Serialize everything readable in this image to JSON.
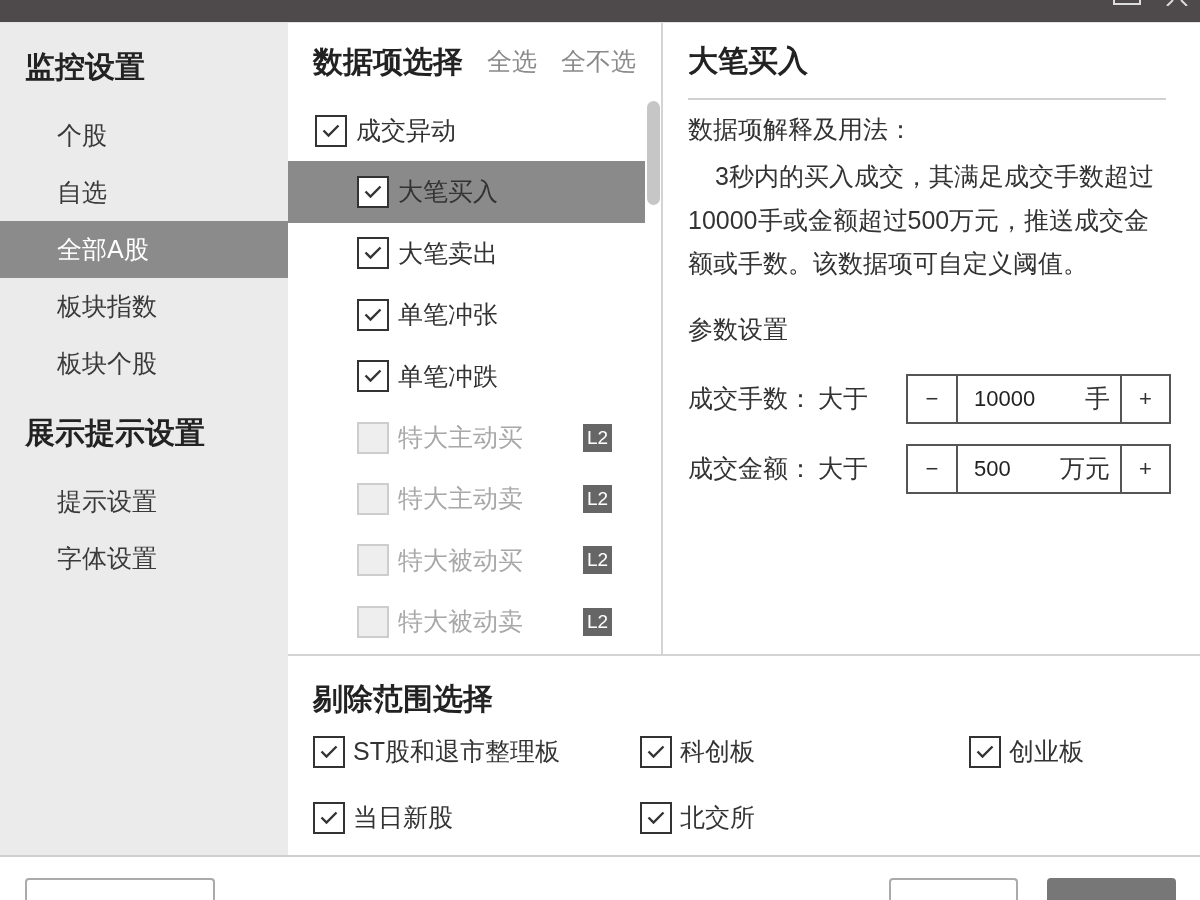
{
  "sidebar": {
    "sections": [
      {
        "heading": "监控设置",
        "items": [
          {
            "label": "个股",
            "selected": false
          },
          {
            "label": "自选",
            "selected": false
          },
          {
            "label": "全部A股",
            "selected": true
          },
          {
            "label": "板块指数",
            "selected": false
          },
          {
            "label": "板块个股",
            "selected": false
          }
        ]
      },
      {
        "heading": "展示提示设置",
        "items": [
          {
            "label": "提示设置",
            "selected": false
          },
          {
            "label": "字体设置",
            "selected": false
          }
        ]
      }
    ]
  },
  "data_items": {
    "title": "数据项选择",
    "actions": [
      "全选",
      "全不选"
    ],
    "tree": [
      {
        "label": "成交异动",
        "checked": true,
        "disabled": false,
        "selected": false,
        "children": [
          {
            "label": "大笔买入",
            "checked": true,
            "disabled": false,
            "selected": true
          },
          {
            "label": "大笔卖出",
            "checked": true,
            "disabled": false,
            "selected": false
          },
          {
            "label": "单笔冲张",
            "checked": true,
            "disabled": false,
            "selected": false
          },
          {
            "label": "单笔冲跌",
            "checked": true,
            "disabled": false,
            "selected": false
          },
          {
            "label": "特大主动买",
            "checked": false,
            "disabled": true,
            "selected": false,
            "badge": "L2"
          },
          {
            "label": "特大主动卖",
            "checked": false,
            "disabled": true,
            "selected": false,
            "badge": "L2"
          },
          {
            "label": "特大被动买",
            "checked": false,
            "disabled": true,
            "selected": false,
            "badge": "L2"
          },
          {
            "label": "特大被动卖",
            "checked": false,
            "disabled": true,
            "selected": false,
            "badge": "L2"
          }
        ]
      }
    ]
  },
  "detail": {
    "title": "大笔买入",
    "usage_label": "数据项解释及用法：",
    "description": "3秒内的买入成交，其满足成交手数超过10000手或金额超过500万元，推送成交金额或手数。该数据项可自定义阈值。",
    "params_heading": "参数设置",
    "params": [
      {
        "label": "成交手数：",
        "condition": "大于",
        "decrement": "−",
        "value": "10000",
        "unit": "手",
        "increment": "+"
      },
      {
        "label": "成交金额：",
        "condition": "大于",
        "decrement": "−",
        "value": "500",
        "unit": "万元",
        "increment": "+"
      }
    ]
  },
  "exclusions": {
    "title": "剔除范围选择",
    "options": [
      {
        "label": "ST股和退市整理板",
        "checked": true
      },
      {
        "label": "科创板",
        "checked": true
      },
      {
        "label": "创业板",
        "checked": true
      },
      {
        "label": "当日新股",
        "checked": true
      },
      {
        "label": "北交所",
        "checked": true
      }
    ]
  },
  "footer": {
    "left_buttons": [
      {
        "kind": "default"
      }
    ],
    "right_buttons": [
      {
        "kind": "default"
      },
      {
        "kind": "primary"
      }
    ]
  }
}
